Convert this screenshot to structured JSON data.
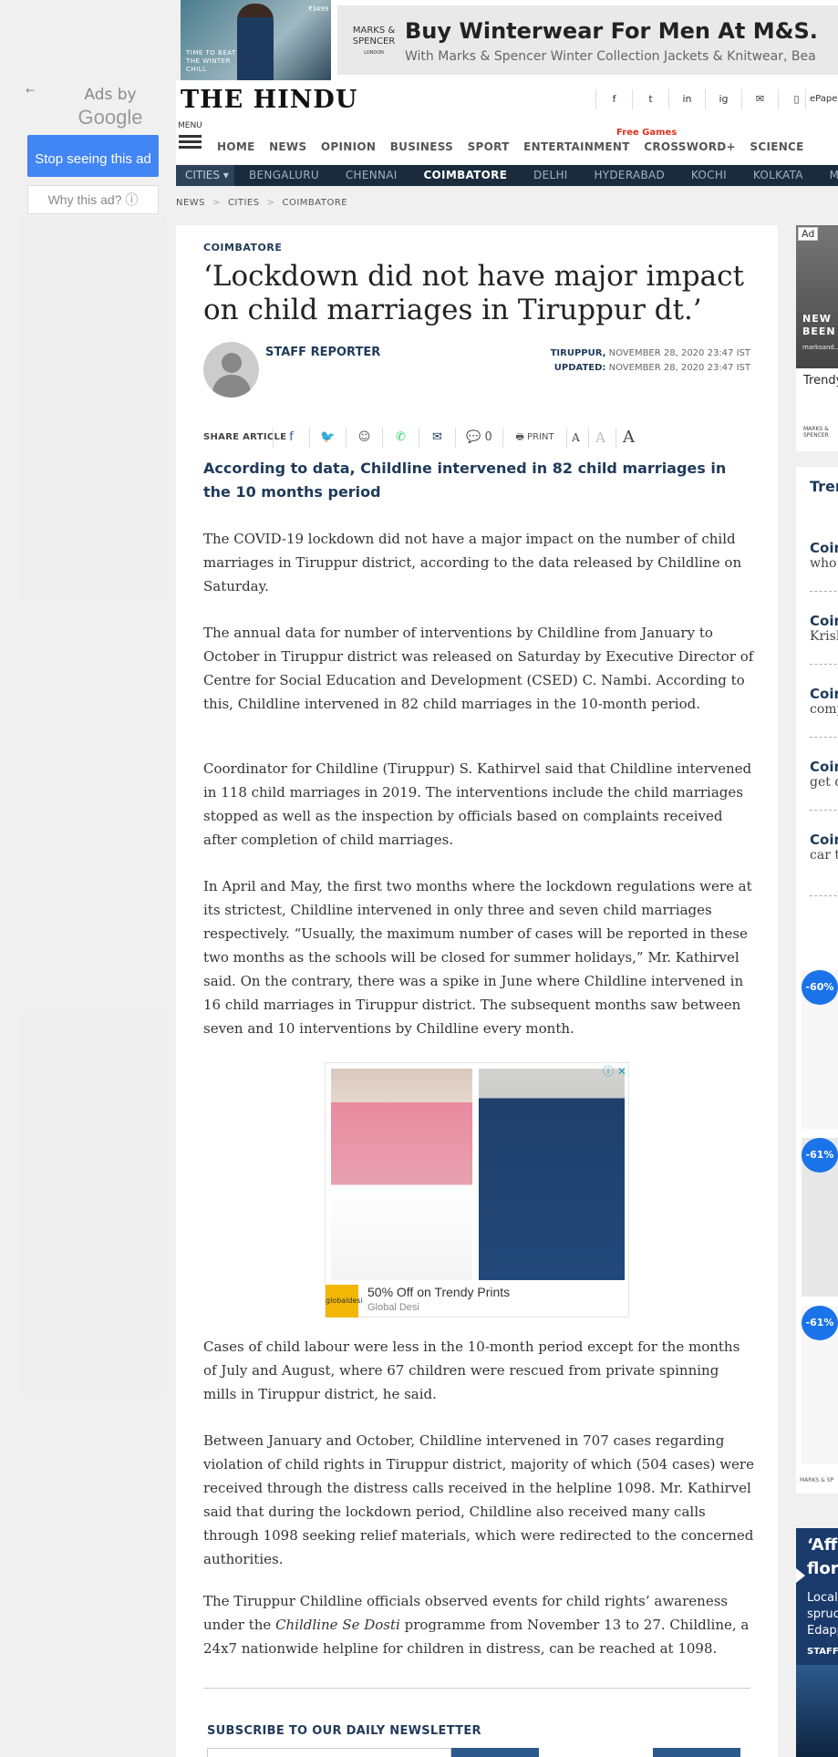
{
  "top_ad": {
    "headline": "Buy Winterwear For Men At M&S.",
    "subline": "With Marks & Spencer Winter Collection Jackets & Knitwear, Bea",
    "brand_logo": "MARKS & SPENCER",
    "brand_sub": "LONDON",
    "image_tagline": "TIME TO BEAT THE WINTER CHILL",
    "image_price": "₹3499"
  },
  "left_ad": {
    "back_icon": "arrow-left-icon",
    "ads_by": "Ads by",
    "google": "Google",
    "stop_label": "Stop seeing this ad",
    "why_label": "Why this ad? ⓘ"
  },
  "header": {
    "logo": "THE HINDU",
    "social": [
      "f",
      "t",
      "in",
      "ig",
      "✉",
      "▯"
    ],
    "epaper": "ePaper",
    "menu_label": "MENU",
    "nav": [
      "HOME",
      "NEWS",
      "OPINION",
      "BUSINESS",
      "SPORT",
      "ENTERTAINMENT",
      "CROSSWORD+",
      "SCIENCE"
    ],
    "free_games": "Free Games"
  },
  "cities": {
    "label": "CITIES ▾",
    "items": [
      "BENGALURU",
      "CHENNAI",
      "COIMBATORE",
      "DELHI",
      "HYDERABAD",
      "KOCHI",
      "KOLKATA",
      "MUMBAI"
    ],
    "active": "COIMBATORE"
  },
  "breadcrumb": [
    "NEWS",
    "CITIES",
    "COIMBATORE"
  ],
  "article": {
    "kicker": "COIMBATORE",
    "headline": "‘Lockdown did not have major impact on child marriages in Tiruppur dt.’",
    "author": "STAFF REPORTER",
    "location": "TIRUPPUR,",
    "published": "NOVEMBER 28, 2020 23:47 IST",
    "updated_label": "UPDATED:",
    "updated": "NOVEMBER 28, 2020 23:47 IST",
    "share_label": "SHARE ARTICLE",
    "comment_count": "0",
    "print_label": "PRINT",
    "subhead": "According to data, Childline intervened in 82 child marriages in the 10 months period",
    "p1": "The COVID-19 lockdown did not have a major impact on the number of child marriages in Tiruppur district, according to the data released by Childline on Saturday.",
    "p2": "The annual data for number of interventions by Childline from January to October in Tiruppur district was released on Saturday by Executive Director of Centre for Social Education and Development (CSED) C. Nambi. According to this, Childline intervened in 82 child marriages in the 10-month period.",
    "p3": "Coordinator for Childline (Tiruppur) S. Kathirvel said that Childline intervened in 118 child marriages in 2019. The interventions include the child marriages stopped as well as the inspection by officials based on complaints received after completion of child marriages.",
    "p4": "In April and May, the first two months where the lockdown regulations were at its strictest, Childline intervened in only three and seven child marriages respectively. “Usually, the maximum number of cases will be reported in these two months as the schools will be closed for summer holidays,” Mr. Kathirvel said. On the contrary, there was a spike in June where Childline intervened in 16 child marriages in Tiruppur district. The subsequent months saw between seven and 10 interventions by Childline every month.",
    "p5": "Cases of child labour were less in the 10-month period except for the months of July and August, where 67 children were rescued from private spinning mills in Tiruppur district, he said.",
    "p6": "Between January and October, Childline intervened in 707 cases regarding violation of child rights in Tiruppur district, majority of which (504 cases) were received through the distress calls received in the helpline 1098. Mr. Kathirvel said that during the lockdown period, Childline also received many calls through 1098 seeking relief materials, which were redirected to the concerned authorities.",
    "p7_a": "The Tiruppur Childline officials observed events for child rights’ awareness under the ",
    "p7_i": "Childline Se Dosti",
    "p7_b": " programme from November 13 to 27. Childline, a 24x7 nationwide helpline for children in distress, can be reached at 1098.",
    "newsletter": "SUBSCRIBE TO OUR DAILY NEWSLETTER"
  },
  "inline_ad": {
    "title": "50% Off on Trendy Prints",
    "advertiser": "Global Desi",
    "brand": "globaldesi"
  },
  "right_ad": {
    "label": "Ad",
    "text": "NEW BEEN",
    "subtext": "marksand...",
    "trend": "Trendy",
    "brand": "MARKS & SPENCER"
  },
  "trending": {
    "title": "Tren",
    "items": [
      {
        "a": "Coim",
        "b": "who"
      },
      {
        "a": "Coim",
        "b": "Krish"
      },
      {
        "a": "Coim",
        "b": "comp"
      },
      {
        "a": "Coim",
        "b": "get d"
      },
      {
        "a": "Coim",
        "b": "car ti"
      }
    ]
  },
  "shop": {
    "badges": [
      "-60%",
      "-61%",
      "-61%"
    ],
    "brand": "MARKS & SP"
  },
  "promo": {
    "title": "‘Affo flora",
    "text": "Local spruc Edapp",
    "author": "STAFF"
  }
}
